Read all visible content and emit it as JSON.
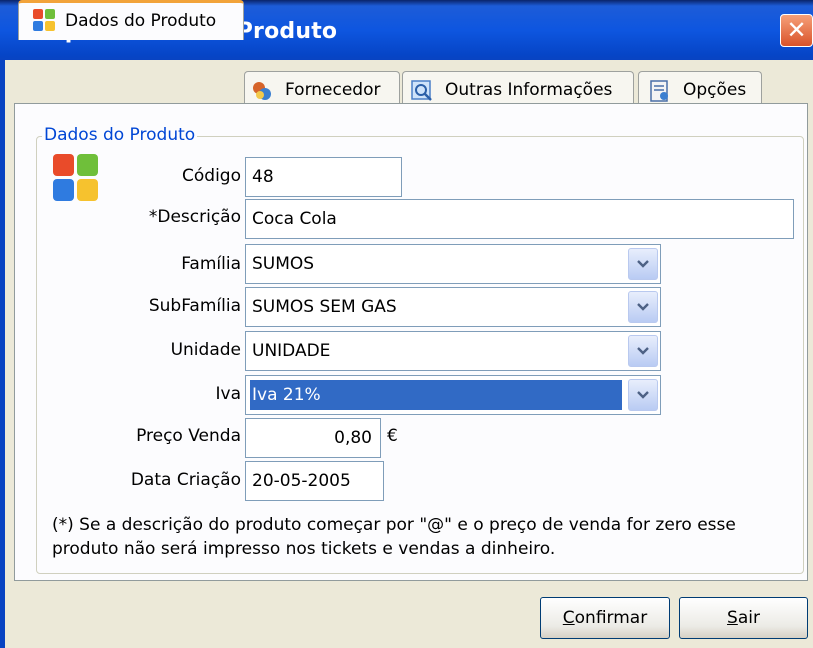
{
  "window": {
    "title": "Propriedades de Produto",
    "close_glyph": "✕"
  },
  "tabs": [
    {
      "label": "Dados do Produto",
      "icon": "grid-icon",
      "active": true
    },
    {
      "label": "Fornecedor",
      "icon": "supplier-icon",
      "active": false
    },
    {
      "label": "Outras Informações",
      "icon": "magnifier-icon",
      "active": false
    },
    {
      "label": "Opções",
      "icon": "options-icon",
      "active": false
    }
  ],
  "group": {
    "title": "Dados do Produto"
  },
  "fields": {
    "codigo": {
      "label": "Código",
      "value": "48"
    },
    "descricao": {
      "label": "*Descrição",
      "value": "Coca Cola"
    },
    "familia": {
      "label": "Família",
      "value": "SUMOS"
    },
    "subfamilia": {
      "label": "SubFamília",
      "value": "SUMOS SEM GAS"
    },
    "unidade": {
      "label": "Unidade",
      "value": "UNIDADE"
    },
    "iva": {
      "label": "Iva",
      "value": "Iva 21%"
    },
    "preco": {
      "label": "Preço Venda",
      "value": "0,80",
      "currency": "€"
    },
    "data": {
      "label": "Data Criação",
      "value": "20-05-2005"
    }
  },
  "note": {
    "line1": "(*) Se a descrição do produto começar por \"@\" e o preço de venda for zero  esse",
    "line2": "produto não será impresso nos tickets e vendas a dinheiro."
  },
  "buttons": {
    "confirm": {
      "accel": "C",
      "rest": "onfirmar"
    },
    "exit": {
      "accel": "S",
      "rest": "air"
    }
  },
  "colors": {
    "titlebar": "#0A52D9",
    "accent_tab": "#F2A33A",
    "selection": "#316AC5",
    "group_title": "#0046D5"
  }
}
